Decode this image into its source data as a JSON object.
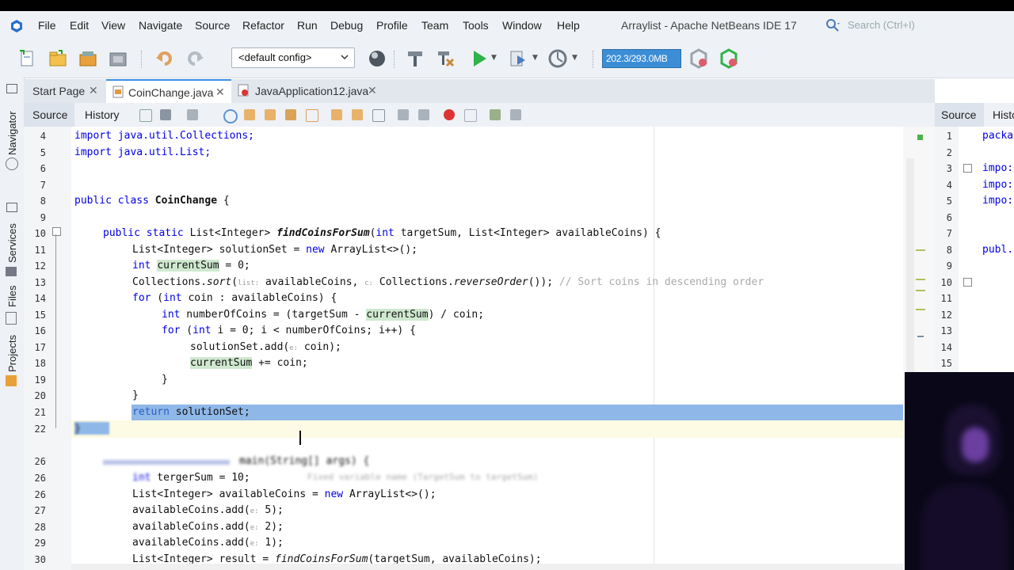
{
  "menu": {
    "items": [
      "File",
      "Edit",
      "View",
      "Navigate",
      "Source",
      "Refactor",
      "Run",
      "Debug",
      "Profile",
      "Team",
      "Tools",
      "Window",
      "Help"
    ],
    "window_title": "Arraylist - Apache NetBeans IDE 17",
    "search_placeholder": "Search (Ctrl+I)"
  },
  "toolbar": {
    "config": "<default config>",
    "memory": "202.3/293.0MB",
    "icons": [
      "new-file-icon",
      "new-project-icon",
      "open-project-icon",
      "close-project-icon",
      "undo-icon",
      "redo-icon",
      "globe-icon",
      "build-hammer-icon",
      "clean-build-icon",
      "run-icon",
      "debug-icon",
      "profile-icon",
      "gc-icon",
      "gc-alt-icon"
    ]
  },
  "side_panels": [
    "Navigator",
    "Services",
    "Files",
    "Projects"
  ],
  "tabs": [
    {
      "label": "Start Page",
      "active": false
    },
    {
      "label": "CoinChange.java",
      "active": true
    },
    {
      "label": "JavaApplication12.java",
      "active": false
    }
  ],
  "editor_tabs": {
    "source": "Source",
    "history": "History"
  },
  "right_pane": {
    "source": "Source",
    "history": "Histo",
    "line_numbers": [
      "1",
      "2",
      "3",
      "4",
      "5",
      "6",
      "7",
      "8",
      "9",
      "10",
      "11",
      "12",
      "13",
      "14",
      "15"
    ],
    "code": [
      "packa",
      "",
      "impo:",
      "impo:",
      "impo:",
      "",
      "",
      "publ.",
      "",
      "",
      "",
      "",
      "",
      "",
      ""
    ]
  },
  "line_numbers": [
    "4",
    "5",
    "6",
    "7",
    "8",
    "9",
    "10",
    "11",
    "12",
    "13",
    "14",
    "15",
    "16",
    "17",
    "18",
    "19",
    "20",
    "21",
    "22",
    "",
    "26",
    "26",
    "26",
    "27",
    "28",
    "29",
    "30"
  ],
  "code": {
    "l4": "import java.util.Collections;",
    "l5": "import java.util.List;",
    "l8_kw": "public class ",
    "l8_name": "CoinChange",
    "l8_end": " {",
    "l10_kw": "public static ",
    "l10_type": "List<Integer> ",
    "l10_method": "findCoinsForSum",
    "l10_args_a": "(",
    "l10_int": "int",
    "l10_args_b": " targetSum, List<Integer> availableCoins) {",
    "l11_a": "List<Integer> solutionSet = ",
    "l11_new": "new",
    "l11_b": " ArrayList<>();",
    "l12_int": "int ",
    "l12_var": "currentSum",
    "l12_b": " = 0;",
    "l13_a": "Collections.",
    "l13_sort": "sort",
    "l13_b": "(",
    "l13_h1": "list:",
    "l13_c": " availableCoins, ",
    "l13_h2": "c:",
    "l13_d": " Collections.",
    "l13_rev": "reverseOrder",
    "l13_e": "()); ",
    "l13_cm": "// Sort coins in descending order",
    "l14_for": "for",
    "l14_a": " (",
    "l14_int": "int",
    "l14_b": " coin : availableCoins) {",
    "l15_int": "int",
    "l15_a": " numberOfCoins = (targetSum - ",
    "l15_var": "currentSum",
    "l15_b": ") / coin;",
    "l16_for": "for",
    "l16_a": " (",
    "l16_int": "int",
    "l16_b": " i = 0; i < numberOfCoins; i++) {",
    "l17_a": "solutionSet.add(",
    "l17_h": "e:",
    "l17_b": " coin);",
    "l18_var": "currentSum",
    "l18_b": " += coin;",
    "l19": "}",
    "l20": "}",
    "l21_kw": "return",
    "l21_b": " solutionSet;",
    "l22": "}",
    "l24": "main(String[] args) {",
    "l25_int": "int",
    "l25_b": " tergerSum = 10;",
    "l25_cm": "Fixed variable name (TargetSum to targetSum)",
    "l26_a": "List<Integer> availableCoins = ",
    "l26_new": "new",
    "l26_b": " ArrayList<>();",
    "l27_a": "availableCoins.add(",
    "l27_h": "e:",
    "l27_b": " 5);",
    "l28_a": "availableCoins.add(",
    "l28_h": "e:",
    "l28_b": " 2);",
    "l29_a": "availableCoins.add(",
    "l29_h": "e:",
    "l29_b": " 1);",
    "l30_a": "List<Integer> result = ",
    "l30_method": "findCoinsForSum",
    "l30_b": "(targetSum, availableCoins);"
  }
}
